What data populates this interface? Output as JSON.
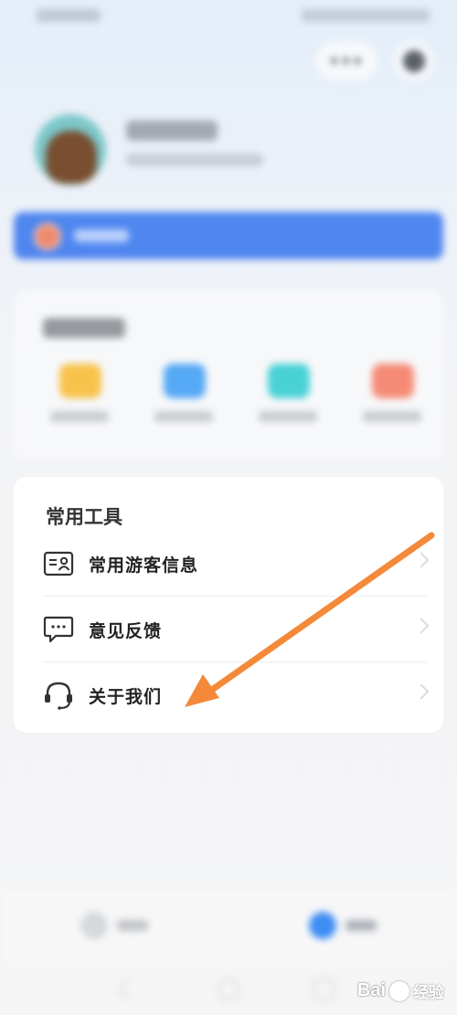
{
  "status_bar": {},
  "header": {
    "more_label": "•••"
  },
  "tools": {
    "title": "常用工具",
    "items": [
      {
        "label": "常用游客信息",
        "icon": "visitor-card-icon"
      },
      {
        "label": "意见反馈",
        "icon": "feedback-chat-icon"
      },
      {
        "label": "关于我们",
        "icon": "headset-icon"
      }
    ]
  },
  "recent": {
    "icons": [
      {
        "color": "#f8c34b"
      },
      {
        "color": "#56a9f5"
      },
      {
        "color": "#49d2d6"
      },
      {
        "color": "#f58b76"
      }
    ]
  },
  "colors": {
    "member_banner": "#4f86ef",
    "annotation_arrow": "#f4893a",
    "tab_active": "#3e8df4"
  },
  "watermark": {
    "brand": "Bai",
    "brand_suffix": "经验"
  }
}
